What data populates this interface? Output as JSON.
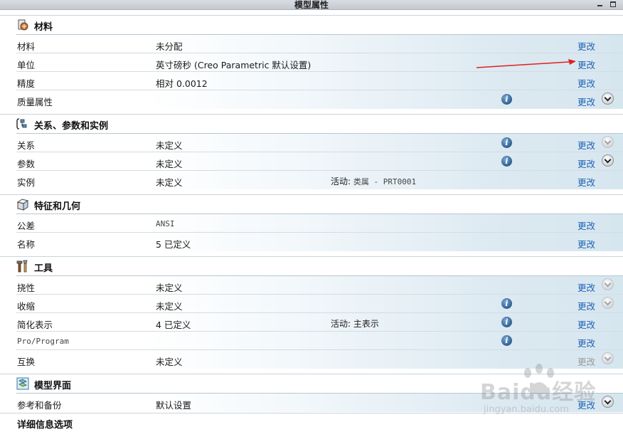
{
  "window": {
    "title": "模型属性"
  },
  "sections": [
    {
      "title": "材料",
      "icon": "material-icon",
      "rows": [
        {
          "label": "材料",
          "value": "未分配",
          "change": "更改"
        },
        {
          "label": "单位",
          "value": "英寸磅秒 (Creo Parametric 默认设置)",
          "change": "更改"
        },
        {
          "label": "精度",
          "value": "相对 0.0012",
          "change": "更改"
        },
        {
          "label": "质量属性",
          "value": "",
          "change": "更改",
          "info": true,
          "expand": true
        }
      ]
    },
    {
      "title": "关系、参数和实例",
      "icon": "relations-icon",
      "rows": [
        {
          "label": "关系",
          "value": "未定义",
          "change": "更改",
          "info": true,
          "expand": "faded"
        },
        {
          "label": "参数",
          "value": "未定义",
          "change": "更改",
          "info": true,
          "expand": true
        },
        {
          "label": "实例",
          "value": "未定义",
          "value2_label": "活动:",
          "value2": "类属 - PRT0001",
          "change": "更改"
        }
      ]
    },
    {
      "title": "特征和几何",
      "icon": "feature-geometry-icon",
      "rows": [
        {
          "label": "公差",
          "value": "ANSI",
          "change": "更改"
        },
        {
          "label": "名称",
          "value": "5 已定义",
          "change": "更改"
        }
      ]
    },
    {
      "title": "工具",
      "icon": "tools-icon",
      "rows": [
        {
          "label": "挠性",
          "value": "未定义",
          "change": "更改",
          "expand": "faded"
        },
        {
          "label": "收缩",
          "value": "未定义",
          "change": "更改",
          "info": true,
          "expand": "faded"
        },
        {
          "label": "简化表示",
          "value": "4 已定义",
          "value2_label": "活动:",
          "value2": "主表示",
          "change": "更改",
          "info": true
        },
        {
          "label": "Pro/Program",
          "value": "",
          "change": "更改",
          "info": true
        },
        {
          "label": "互换",
          "value": "未定义",
          "change": "更改",
          "disabled": true,
          "expand": "faded"
        }
      ]
    },
    {
      "title": "模型界面",
      "icon": "model-interface-icon",
      "rows": [
        {
          "label": "参考和备份",
          "value": "默认设置",
          "change": "更改",
          "expand": true
        }
      ]
    },
    {
      "title": "详细信息选项",
      "icon": "",
      "rows": []
    }
  ],
  "watermark": {
    "text": "Baidu经验",
    "sub": "jingyan.baidu.com"
  },
  "colors": {
    "link": "#1f63b5",
    "annotation_arrow": "#e02020"
  }
}
